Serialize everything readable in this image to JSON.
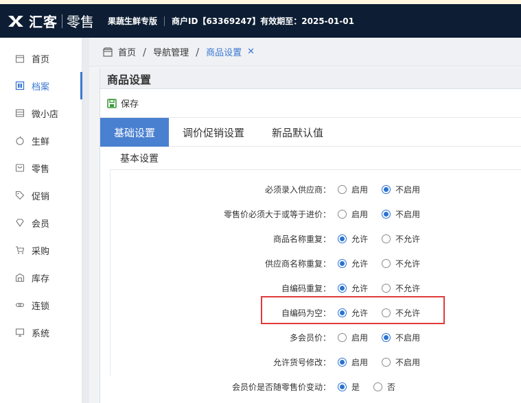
{
  "header": {
    "logo_text": "汇客",
    "logo_sub": "零售",
    "edition": "果蔬生鲜专版",
    "merchant_info": "商户ID【63369247】有效期至：2025-01-01"
  },
  "sidebar": {
    "items": [
      {
        "label": "首页",
        "icon": "home-icon"
      },
      {
        "label": "档案",
        "icon": "archive-icon"
      },
      {
        "label": "微小店",
        "icon": "store-icon"
      },
      {
        "label": "生鲜",
        "icon": "apple-icon"
      },
      {
        "label": "零售",
        "icon": "retail-icon"
      },
      {
        "label": "促销",
        "icon": "tag-icon"
      },
      {
        "label": "会员",
        "icon": "member-icon"
      },
      {
        "label": "采购",
        "icon": "cart-icon"
      },
      {
        "label": "库存",
        "icon": "warehouse-icon"
      },
      {
        "label": "连锁",
        "icon": "chain-icon"
      },
      {
        "label": "系统",
        "icon": "system-icon"
      }
    ],
    "active_index": 1
  },
  "breadcrumb": {
    "home": "首页",
    "nav": "导航管理",
    "current": "商品设置",
    "close": "✕"
  },
  "panel": {
    "title": "商品设置",
    "save_label": "保存"
  },
  "tabs": [
    {
      "label": "基础设置",
      "active": true
    },
    {
      "label": "调价促销设置",
      "active": false
    },
    {
      "label": "新品默认值",
      "active": false
    }
  ],
  "section_title": "基本设置",
  "settings": [
    {
      "label": "必须录入供应商：",
      "options": [
        "启用",
        "不启用"
      ],
      "selected": 1
    },
    {
      "label": "零售价必须大于或等于进价：",
      "options": [
        "启用",
        "不启用"
      ],
      "selected": 1
    },
    {
      "label": "商品名称重复：",
      "options": [
        "允许",
        "不允许"
      ],
      "selected": 0
    },
    {
      "label": "供应商名称重复：",
      "options": [
        "允许",
        "不允许"
      ],
      "selected": 0
    },
    {
      "label": "自编码重复：",
      "options": [
        "允许",
        "不允许"
      ],
      "selected": 0
    },
    {
      "label": "自编码为空：",
      "options": [
        "允许",
        "不允许"
      ],
      "selected": 0
    },
    {
      "label": "多会员价：",
      "options": [
        "启用",
        "不启用"
      ],
      "selected": 1
    },
    {
      "label": "允许货号修改：",
      "options": [
        "启用",
        "不启用"
      ],
      "selected": 0
    },
    {
      "label": "会员价是否随零售价变动：",
      "options": [
        "是",
        "否"
      ],
      "selected": 0
    }
  ],
  "colors": {
    "topbar": "#0d1d33",
    "accent": "#3a78d1",
    "tab_active": "#4a80d0",
    "highlight": "#e03a3a",
    "save_icon": "#3c9a3c"
  }
}
